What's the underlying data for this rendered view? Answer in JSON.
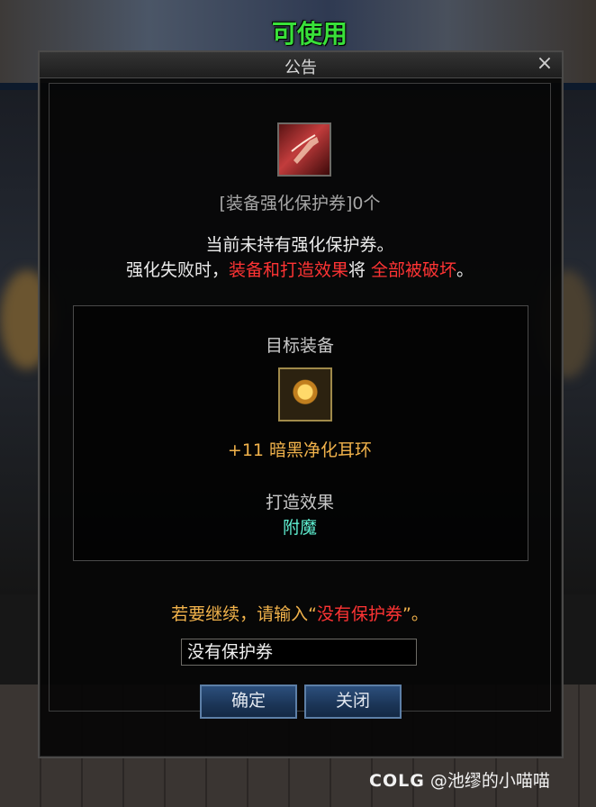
{
  "header": {
    "usable_tag": "可使用"
  },
  "dialog": {
    "title": "公告",
    "close_symbol": "×",
    "protect_ticket_count": "[装备强化保护券]0个",
    "notice_line1": "当前未持有强化保护券。",
    "notice_line2": {
      "part1": "强化失败时，",
      "part2": "装备和打造效果",
      "part3": "将 ",
      "part4": "全部被破坏",
      "part5": "。"
    },
    "target_label": "目标装备",
    "target_item": "+11 暗黑净化耳环",
    "effect_label": "打造效果",
    "effect_value": "附魔",
    "continue_prompt": {
      "part1": "若要继续，请输入“",
      "part2": "没有保护券",
      "part3": "”。"
    },
    "input_value": "没有保护券",
    "confirm_button": "确定",
    "close_button": "关闭"
  },
  "watermark": {
    "logo": "COLG",
    "text": "@池缪的小喵喵"
  },
  "colors": {
    "accent_red": "#ff3434",
    "item_orange": "#f1b24b",
    "effect_green": "#5ff0d2",
    "usable_green": "#39e03a"
  }
}
